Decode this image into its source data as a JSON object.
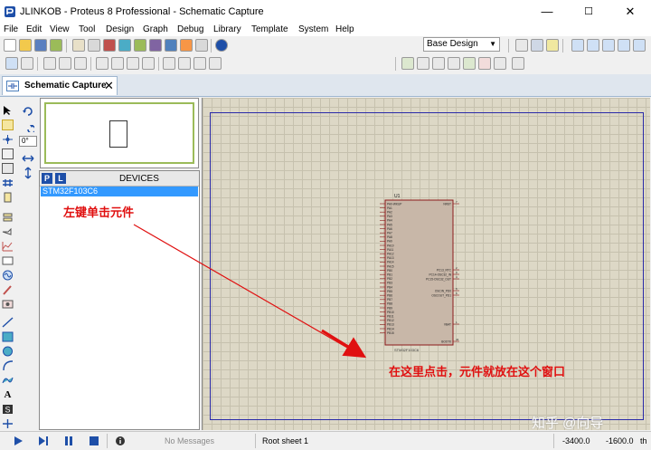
{
  "window": {
    "title": "JLINKOB - Proteus 8 Professional - Schematic Capture",
    "controls": {
      "minimize": "—",
      "maximize": "☐",
      "close": "✕"
    }
  },
  "menu": [
    "File",
    "Edit",
    "View",
    "Tool",
    "Design",
    "Graph",
    "Debug",
    "Library",
    "Template",
    "System",
    "Help"
  ],
  "toolbar": {
    "design_select": "Base Design"
  },
  "tabs": [
    {
      "label": "Schematic Capture",
      "close": "✕"
    }
  ],
  "rotation": {
    "angle": "0°"
  },
  "devices": {
    "p_button": "P",
    "l_button": "L",
    "title": "DEVICES",
    "items": [
      "STM32F103C6"
    ]
  },
  "component": {
    "ref": "U1",
    "part_label": "STM32F103C6",
    "pins_left": [
      "PA0-WKUP",
      "PA1",
      "PA2",
      "PA3",
      "PA4",
      "PA5",
      "PA6",
      "PA7",
      "PA8",
      "PA9",
      "PA10",
      "PA11",
      "PA12",
      "PA13",
      "PA14",
      "PA15",
      "PB0",
      "PB1",
      "PB2",
      "PB3",
      "PB4",
      "PB5",
      "PB6",
      "PB7",
      "PB8",
      "PB9",
      "PB10",
      "PB11",
      "PB12",
      "PB13",
      "PB14",
      "PB15"
    ],
    "pins_right": [
      "NRST",
      "PC13_RTC",
      "PC14-OSC32_IN",
      "PC15-OSC32_OUT",
      "OSCIN_PD0",
      "OSCOUT_PD1",
      "VBAT",
      "BOOT0"
    ],
    "pin_numbers_right": [
      "7",
      "2",
      "3",
      "4",
      "5",
      "6",
      "1",
      "44"
    ]
  },
  "annotations": {
    "left": "左键单击元件",
    "right": "在这里点击，元件就放在这个窗口",
    "color": "#e01010"
  },
  "watermark": "知乎 @向导",
  "status": {
    "messages": "No Messages",
    "sheet": "Root sheet 1",
    "x": "-3400.0",
    "y": "-1600.0",
    "unit": "th"
  }
}
